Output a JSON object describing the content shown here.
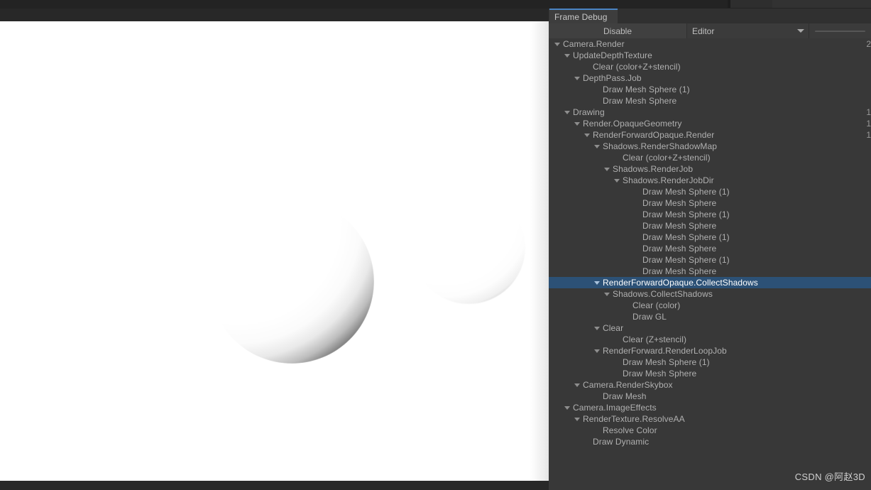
{
  "window": {
    "title": "Frame Debug"
  },
  "toolbar": {
    "disable_label": "Disable",
    "target_dropdown_value": "Editor",
    "target_dropdown_options": [
      "Editor"
    ],
    "slider_value": ""
  },
  "colors": {
    "panel_bg": "#383838",
    "selection_blue": "#2c5176",
    "tab_accent": "#4a84c4",
    "toolbar_bg": "#3b3b3b",
    "text": "#b0b0b0",
    "preview_bg": "#ffffff"
  },
  "preview": {
    "description": "CollectShadows render target: white screen-space shadow mask with two dark crescent sphere terminators"
  },
  "tree": [
    {
      "label": "Camera.Render",
      "depth": 0,
      "arrow": true,
      "count": "2"
    },
    {
      "label": "UpdateDepthTexture",
      "depth": 1,
      "arrow": true,
      "count": ""
    },
    {
      "label": "Clear (color+Z+stencil)",
      "depth": 3,
      "arrow": false,
      "count": ""
    },
    {
      "label": "DepthPass.Job",
      "depth": 2,
      "arrow": true,
      "count": ""
    },
    {
      "label": "Draw Mesh Sphere (1)",
      "depth": 4,
      "arrow": false,
      "count": ""
    },
    {
      "label": "Draw Mesh Sphere",
      "depth": 4,
      "arrow": false,
      "count": ""
    },
    {
      "label": "Drawing",
      "depth": 1,
      "arrow": true,
      "count": "1"
    },
    {
      "label": "Render.OpaqueGeometry",
      "depth": 2,
      "arrow": true,
      "count": "1"
    },
    {
      "label": "RenderForwardOpaque.Render",
      "depth": 3,
      "arrow": true,
      "count": "1"
    },
    {
      "label": "Shadows.RenderShadowMap",
      "depth": 4,
      "arrow": true,
      "count": ""
    },
    {
      "label": "Clear (color+Z+stencil)",
      "depth": 6,
      "arrow": false,
      "count": ""
    },
    {
      "label": "Shadows.RenderJob",
      "depth": 5,
      "arrow": true,
      "count": ""
    },
    {
      "label": "Shadows.RenderJobDir",
      "depth": 6,
      "arrow": true,
      "count": ""
    },
    {
      "label": "Draw Mesh Sphere (1)",
      "depth": 8,
      "arrow": false,
      "count": ""
    },
    {
      "label": "Draw Mesh Sphere",
      "depth": 8,
      "arrow": false,
      "count": ""
    },
    {
      "label": "Draw Mesh Sphere (1)",
      "depth": 8,
      "arrow": false,
      "count": ""
    },
    {
      "label": "Draw Mesh Sphere",
      "depth": 8,
      "arrow": false,
      "count": ""
    },
    {
      "label": "Draw Mesh Sphere (1)",
      "depth": 8,
      "arrow": false,
      "count": ""
    },
    {
      "label": "Draw Mesh Sphere",
      "depth": 8,
      "arrow": false,
      "count": ""
    },
    {
      "label": "Draw Mesh Sphere (1)",
      "depth": 8,
      "arrow": false,
      "count": ""
    },
    {
      "label": "Draw Mesh Sphere",
      "depth": 8,
      "arrow": false,
      "count": ""
    },
    {
      "label": "RenderForwardOpaque.CollectShadows",
      "depth": 4,
      "arrow": true,
      "count": "",
      "selected": true
    },
    {
      "label": "Shadows.CollectShadows",
      "depth": 5,
      "arrow": true,
      "count": ""
    },
    {
      "label": "Clear (color)",
      "depth": 7,
      "arrow": false,
      "count": ""
    },
    {
      "label": "Draw GL",
      "depth": 7,
      "arrow": false,
      "count": ""
    },
    {
      "label": "Clear",
      "depth": 4,
      "arrow": true,
      "count": ""
    },
    {
      "label": "Clear (Z+stencil)",
      "depth": 6,
      "arrow": false,
      "count": ""
    },
    {
      "label": "RenderForward.RenderLoopJob",
      "depth": 4,
      "arrow": true,
      "count": ""
    },
    {
      "label": "Draw Mesh Sphere (1)",
      "depth": 6,
      "arrow": false,
      "count": ""
    },
    {
      "label": "Draw Mesh Sphere",
      "depth": 6,
      "arrow": false,
      "count": ""
    },
    {
      "label": "Camera.RenderSkybox",
      "depth": 2,
      "arrow": true,
      "count": ""
    },
    {
      "label": "Draw Mesh",
      "depth": 4,
      "arrow": false,
      "count": ""
    },
    {
      "label": "Camera.ImageEffects",
      "depth": 1,
      "arrow": true,
      "count": ""
    },
    {
      "label": "RenderTexture.ResolveAA",
      "depth": 2,
      "arrow": true,
      "count": ""
    },
    {
      "label": "Resolve Color",
      "depth": 4,
      "arrow": false,
      "count": ""
    },
    {
      "label": "Draw Dynamic",
      "depth": 3,
      "arrow": false,
      "count": ""
    }
  ],
  "watermark": {
    "text": "CSDN @阿赵3D"
  }
}
